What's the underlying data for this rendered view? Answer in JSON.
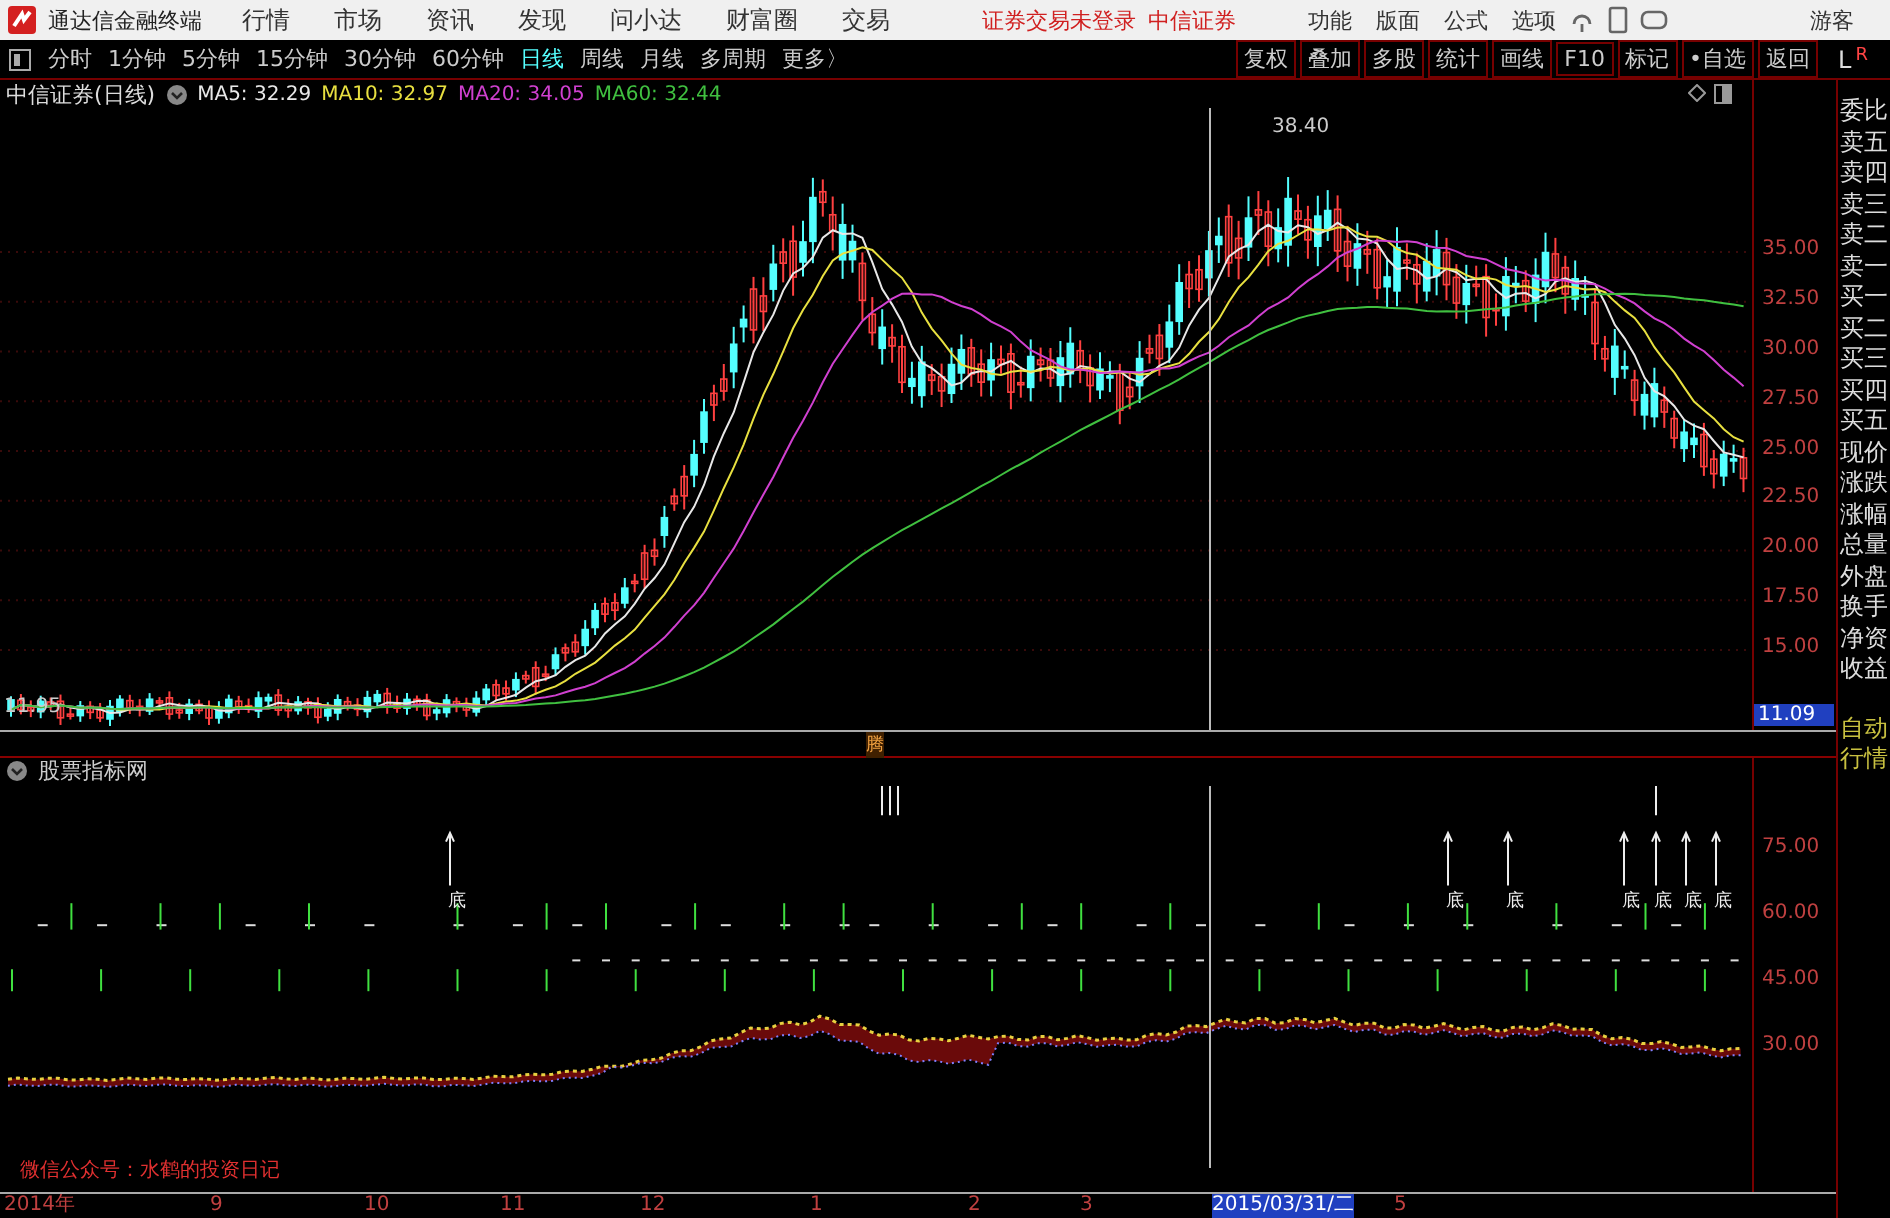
{
  "title_bar": {
    "app_name": "通达信金融终端",
    "menus": [
      "行情",
      "市场",
      "资讯",
      "发现",
      "问小达",
      "财富圈",
      "交易"
    ],
    "login_notice": "证券交易未登录",
    "broker": "中信证券",
    "tools": [
      "功能",
      "版面",
      "公式",
      "选项"
    ],
    "user": "游客"
  },
  "toolbar": {
    "periods": [
      {
        "label": "分时",
        "selected": false
      },
      {
        "label": "1分钟",
        "selected": false
      },
      {
        "label": "5分钟",
        "selected": false
      },
      {
        "label": "15分钟",
        "selected": false
      },
      {
        "label": "30分钟",
        "selected": false
      },
      {
        "label": "60分钟",
        "selected": false
      },
      {
        "label": "日线",
        "selected": true
      },
      {
        "label": "周线",
        "selected": false
      },
      {
        "label": "月线",
        "selected": false
      },
      {
        "label": "多周期",
        "selected": false
      },
      {
        "label": "更多〉",
        "selected": false
      }
    ],
    "buttons": [
      "复权",
      "叠加",
      "多股",
      "统计",
      "画线",
      "F10",
      "标记",
      "•自选",
      "返回"
    ],
    "corner": [
      "L",
      "R"
    ]
  },
  "price_panel": {
    "title": "中信证券(日线)",
    "averages": [
      {
        "label": "MA5: 32.29",
        "color": "#e8e8e8"
      },
      {
        "label": "MA10: 32.97",
        "color": "#e8e040"
      },
      {
        "label": "MA20: 34.05",
        "color": "#d040d0"
      },
      {
        "label": "MA60: 32.44",
        "color": "#40c040"
      }
    ],
    "high_label": "38.40",
    "low_label": "11.95",
    "y_ticks": [
      "35.00",
      "32.50",
      "30.00",
      "27.50",
      "25.00",
      "22.50",
      "20.00",
      "17.50",
      "15.00"
    ],
    "current_price": "11.09"
  },
  "divider_marker": "腾",
  "indicator_panel": {
    "title": "股票指标网",
    "signals": [
      "底",
      "底",
      "底",
      "底",
      "底",
      "底",
      "底"
    ],
    "y_ticks": [
      "75.00",
      "60.00",
      "45.00",
      "30.00"
    ],
    "note": "微信公众号：水鹤的投资日记"
  },
  "date_axis": [
    {
      "label": "2014年",
      "selected": false
    },
    {
      "label": "9",
      "selected": false
    },
    {
      "label": "10",
      "selected": false
    },
    {
      "label": "11",
      "selected": false
    },
    {
      "label": "12",
      "selected": false
    },
    {
      "label": "1",
      "selected": false
    },
    {
      "label": "2",
      "selected": false
    },
    {
      "label": "3",
      "selected": false
    },
    {
      "label": "2015/03/31/二",
      "selected": true
    },
    {
      "label": "5",
      "selected": false
    }
  ],
  "sidebar": {
    "items": [
      "委比",
      "卖五",
      "卖四",
      "卖三",
      "卖二",
      "卖一",
      "买一",
      "买二",
      "买三",
      "买四",
      "买五",
      "现价",
      "涨跌",
      "涨幅",
      "总量",
      "外盘",
      "换手",
      "净资",
      "收益"
    ],
    "auto_button": "自动行情"
  }
}
